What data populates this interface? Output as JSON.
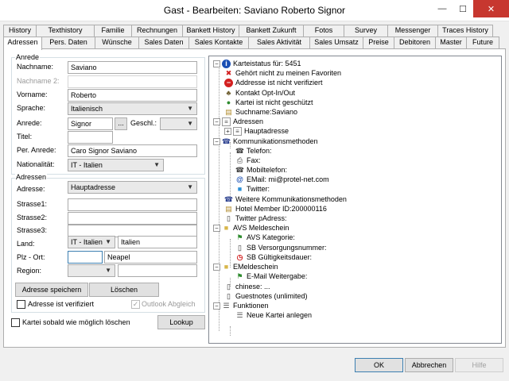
{
  "window": {
    "title": "Gast - Bearbeiten: Saviano Roberto Signor",
    "minimize": "—",
    "maximize": "☐",
    "close": "✕"
  },
  "tabs_row1": [
    "History",
    "Texthistory",
    "Familie",
    "Rechnungen",
    "Bankett History",
    "Bankett Zukunft",
    "Fotos",
    "Survey",
    "Messenger",
    "Traces History"
  ],
  "tabs_row2": [
    "Adressen",
    "Pers. Daten",
    "Wünsche",
    "Sales Daten",
    "Sales Kontakte",
    "Sales Aktivität",
    "Sales Umsatz",
    "Preise",
    "Debitoren",
    "Master",
    "Future"
  ],
  "anrede_group": {
    "title": "Anrede",
    "nachname_label": "Nachname:",
    "nachname_value": "Saviano",
    "nachname2_label": "Nachname 2:",
    "vorname_label": "Vorname:",
    "vorname_value": "Roberto",
    "sprache_label": "Sprache:",
    "sprache_value": "Italienisch",
    "anrede_label": "Anrede:",
    "anrede_value": "Signor",
    "ellipsis": "...",
    "geschl_label": "Geschl.:",
    "titel_label": "Titel:",
    "per_anrede_label": "Per. Anrede:",
    "per_anrede_value": "Caro Signor Saviano",
    "nationalitaet_label": "Nationalität:",
    "nationalitaet_value": "IT - Italien"
  },
  "adressen_group": {
    "title": "Adressen",
    "adresse_label": "Adresse:",
    "adresse_value": "Hauptadresse",
    "strasse1_label": "Strasse1:",
    "strasse2_label": "Strasse2:",
    "strasse3_label": "Strasse3:",
    "land_label": "Land:",
    "land_code": "IT - Italien",
    "land_name": "Italien",
    "plz_label": "Plz - Ort:",
    "ort_value": "Neapel",
    "region_label": "Region:",
    "save_button": "Adresse speichern",
    "delete_button": "Löschen",
    "verified_label": "Adresse ist verifiziert",
    "outlook_label": "Outlook Abgleich",
    "outlook_check": "✓"
  },
  "delete_asap_label": "Kartei sobald wie möglich löschen",
  "lookup_button": "Lookup",
  "tree": [
    {
      "text": "Karteistatus für: 5451",
      "icon": "info-icon",
      "glyph": "i",
      "color": "#1a4fb4"
    },
    {
      "text": "Gehört nicht zu meinen Favoriten",
      "icon": "x-icon",
      "glyph": "✖",
      "color": "#d32020"
    },
    {
      "text": "Addresse ist nicht verifiziert",
      "icon": "no-entry-icon",
      "glyph": "−",
      "color": "#d32020"
    },
    {
      "text": "Kontakt Opt-In/Out",
      "icon": "contact-icon",
      "glyph": "♣",
      "color": "#6b5a2a"
    },
    {
      "text": "Kartei ist nicht geschützt",
      "icon": "unprotected-icon",
      "glyph": "●",
      "color": "#2e8b2e"
    },
    {
      "text": "Suchname:Saviano",
      "icon": "search-name-icon",
      "glyph": "▤",
      "color": "#b08a2a"
    },
    {
      "text": "Adressen",
      "icon": "address-icon",
      "glyph": "≡",
      "color": "#555"
    },
    {
      "text": "Hauptadresse",
      "icon": "address-icon",
      "glyph": "≡",
      "color": "#555"
    },
    {
      "text": "Kommunikationsmethoden",
      "icon": "communication-icon",
      "glyph": "☎",
      "color": "#2a3f8f"
    },
    {
      "text": "Telefon:",
      "icon": "phone-icon",
      "glyph": "☎",
      "color": "#444"
    },
    {
      "text": "Fax:",
      "icon": "fax-icon",
      "glyph": "⎙",
      "color": "#444"
    },
    {
      "text": "Mobiltelefon:",
      "icon": "mobile-icon",
      "glyph": "☎",
      "color": "#444"
    },
    {
      "text": "EMail: mi@protel-net.com",
      "icon": "email-icon",
      "glyph": "@",
      "color": "#1a4fb4"
    },
    {
      "text": "Twitter:",
      "icon": "twitter-icon",
      "glyph": "■",
      "color": "#2b8fd6"
    },
    {
      "text": "Weitere Kommunikationsmethoden",
      "icon": "communication-icon",
      "glyph": "☎",
      "color": "#2a3f8f"
    },
    {
      "text": "Hotel Member ID:200000116",
      "icon": "member-icon",
      "glyph": "▤",
      "color": "#b08a2a"
    },
    {
      "text": "Twitter pAdress:",
      "icon": "card-icon",
      "glyph": "▯",
      "color": "#333"
    },
    {
      "text": "AVS Meldeschein",
      "icon": "folder-icon",
      "glyph": "■",
      "color": "#d8b64a"
    },
    {
      "text": "AVS Kategorie:",
      "icon": "flag-icon",
      "glyph": "⚑",
      "color": "#2e8b2e"
    },
    {
      "text": "SB Versorgungsnummer:",
      "icon": "card-icon",
      "glyph": "▯",
      "color": "#333"
    },
    {
      "text": "SB Gültigkeitsdauer:",
      "icon": "clock-icon",
      "glyph": "◷",
      "color": "#d32020"
    },
    {
      "text": "EMeldeschein",
      "icon": "folder-icon",
      "glyph": "■",
      "color": "#d8b64a"
    },
    {
      "text": "E-Mail Weitergabe:",
      "icon": "flag-icon",
      "glyph": "⚑",
      "color": "#2e8b2e"
    },
    {
      "text": "chinese:  ...",
      "icon": "card-icon",
      "glyph": "▯",
      "color": "#333"
    },
    {
      "text": "Guestnotes (unlimited)",
      "icon": "card-icon",
      "glyph": "▯",
      "color": "#333"
    },
    {
      "text": "Funktionen",
      "icon": "functions-icon",
      "glyph": "☰",
      "color": "#555"
    },
    {
      "text": "Neue Kartei anlegen",
      "icon": "new-card-icon",
      "glyph": "☰",
      "color": "#555"
    }
  ],
  "footer": {
    "ok": "OK",
    "cancel": "Abbrechen",
    "help": "Hilfe"
  }
}
